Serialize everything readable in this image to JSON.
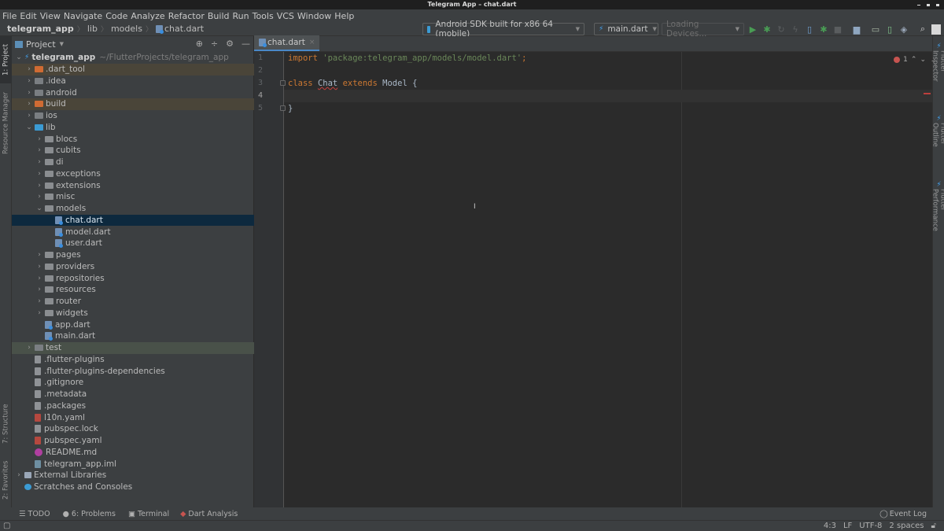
{
  "window": {
    "title": "Telegram App – chat.dart"
  },
  "menu": [
    "File",
    "Edit",
    "View",
    "Navigate",
    "Code",
    "Analyze",
    "Refactor",
    "Build",
    "Run",
    "Tools",
    "VCS",
    "Window",
    "Help"
  ],
  "breadcrumb": {
    "project": "telegram_app",
    "items": [
      "lib",
      "models"
    ],
    "file": "chat.dart"
  },
  "toolbar": {
    "device": "Android SDK built for x86 64 (mobile)",
    "run_config": "main.dart",
    "devices_loading": "Loading Devices..."
  },
  "left_strip": {
    "project_tab": "1: Project",
    "resource_manager": "Resource Manager",
    "structure": "7: Structure",
    "favorites": "2: Favorites"
  },
  "right_strip": {
    "inspector": "Flutter Inspector",
    "outline": "Flutter Outline",
    "performance": "Flutter Performance"
  },
  "project_panel": {
    "title": "Project",
    "root": {
      "name": "telegram_app",
      "path": "~/FlutterProjects/telegram_app"
    },
    "tree": [
      {
        "name": ".dart_tool",
        "type": "folder-orange",
        "depth": 1,
        "chevron": ">",
        "state": "excluded"
      },
      {
        "name": ".idea",
        "type": "folder-gray",
        "depth": 1,
        "chevron": ">",
        "state": ""
      },
      {
        "name": "android",
        "type": "folder-gray",
        "depth": 1,
        "chevron": ">",
        "state": ""
      },
      {
        "name": "build",
        "type": "folder-orange",
        "depth": 1,
        "chevron": ">",
        "state": "excluded"
      },
      {
        "name": "ios",
        "type": "folder-gray",
        "depth": 1,
        "chevron": ">",
        "state": ""
      },
      {
        "name": "lib",
        "type": "folder-blue",
        "depth": 1,
        "chevron": "v",
        "state": ""
      },
      {
        "name": "blocs",
        "type": "folder",
        "depth": 2,
        "chevron": ">",
        "state": ""
      },
      {
        "name": "cubits",
        "type": "folder",
        "depth": 2,
        "chevron": ">",
        "state": ""
      },
      {
        "name": "di",
        "type": "folder",
        "depth": 2,
        "chevron": ">",
        "state": ""
      },
      {
        "name": "exceptions",
        "type": "folder",
        "depth": 2,
        "chevron": ">",
        "state": ""
      },
      {
        "name": "extensions",
        "type": "folder",
        "depth": 2,
        "chevron": ">",
        "state": ""
      },
      {
        "name": "misc",
        "type": "folder",
        "depth": 2,
        "chevron": ">",
        "state": ""
      },
      {
        "name": "models",
        "type": "folder",
        "depth": 2,
        "chevron": "v",
        "state": ""
      },
      {
        "name": "chat.dart",
        "type": "dart",
        "depth": 3,
        "chevron": "",
        "state": "selected"
      },
      {
        "name": "model.dart",
        "type": "dart",
        "depth": 3,
        "chevron": "",
        "state": ""
      },
      {
        "name": "user.dart",
        "type": "dart",
        "depth": 3,
        "chevron": "",
        "state": ""
      },
      {
        "name": "pages",
        "type": "folder",
        "depth": 2,
        "chevron": ">",
        "state": ""
      },
      {
        "name": "providers",
        "type": "folder",
        "depth": 2,
        "chevron": ">",
        "state": ""
      },
      {
        "name": "repositories",
        "type": "folder",
        "depth": 2,
        "chevron": ">",
        "state": ""
      },
      {
        "name": "resources",
        "type": "folder",
        "depth": 2,
        "chevron": ">",
        "state": ""
      },
      {
        "name": "router",
        "type": "folder",
        "depth": 2,
        "chevron": ">",
        "state": ""
      },
      {
        "name": "widgets",
        "type": "folder",
        "depth": 2,
        "chevron": ">",
        "state": ""
      },
      {
        "name": "app.dart",
        "type": "dart",
        "depth": 2,
        "chevron": "",
        "state": ""
      },
      {
        "name": "main.dart",
        "type": "dart",
        "depth": 2,
        "chevron": "",
        "state": ""
      },
      {
        "name": "test",
        "type": "folder-gray",
        "depth": 1,
        "chevron": ">",
        "state": "test"
      },
      {
        "name": ".flutter-plugins",
        "type": "file",
        "depth": 1,
        "chevron": "",
        "state": ""
      },
      {
        "name": ".flutter-plugins-dependencies",
        "type": "file",
        "depth": 1,
        "chevron": "",
        "state": ""
      },
      {
        "name": ".gitignore",
        "type": "file",
        "depth": 1,
        "chevron": "",
        "state": ""
      },
      {
        "name": ".metadata",
        "type": "file",
        "depth": 1,
        "chevron": "",
        "state": ""
      },
      {
        "name": ".packages",
        "type": "file",
        "depth": 1,
        "chevron": "",
        "state": ""
      },
      {
        "name": "l10n.yaml",
        "type": "yaml",
        "depth": 1,
        "chevron": "",
        "state": ""
      },
      {
        "name": "pubspec.lock",
        "type": "file",
        "depth": 1,
        "chevron": "",
        "state": ""
      },
      {
        "name": "pubspec.yaml",
        "type": "yaml",
        "depth": 1,
        "chevron": "",
        "state": ""
      },
      {
        "name": "README.md",
        "type": "md",
        "depth": 1,
        "chevron": "",
        "state": ""
      },
      {
        "name": "telegram_app.iml",
        "type": "iml",
        "depth": 1,
        "chevron": "",
        "state": ""
      },
      {
        "name": "External Libraries",
        "type": "libs",
        "depth": 0,
        "chevron": ">",
        "state": ""
      },
      {
        "name": "Scratches and Consoles",
        "type": "scratch",
        "depth": 0,
        "chevron": "",
        "state": ""
      }
    ]
  },
  "editor": {
    "tab": "chat.dart",
    "line_numbers": [
      "1",
      "2",
      "3",
      "4",
      "5"
    ],
    "current_line": 4,
    "code": {
      "l1_kw": "import",
      "l1_str": "'package:telegram_app/models/model.dart'",
      "l1_end": ";",
      "l3_kw1": "class",
      "l3_name": "Chat",
      "l3_kw2": "extends",
      "l3_base": "Model {",
      "l5": "}"
    },
    "error_count": "1"
  },
  "bottom_tools": [
    "TODO",
    "6: Problems",
    "Terminal",
    "Dart Analysis"
  ],
  "event_log": "Event Log",
  "status": {
    "position": "4:3",
    "line_sep": "LF",
    "encoding": "UTF-8",
    "indent": "2 spaces"
  }
}
